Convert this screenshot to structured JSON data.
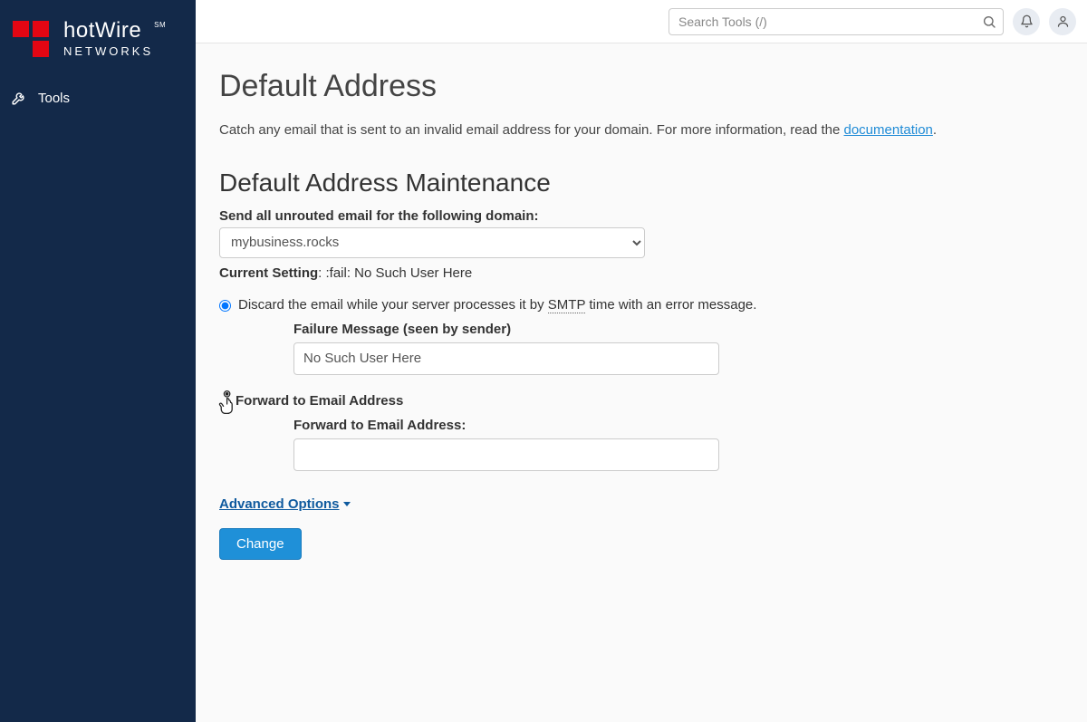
{
  "brand": {
    "name": "hotWire",
    "mark": "SM",
    "sub": "NETWORKS"
  },
  "sidebar": {
    "tools_label": "Tools"
  },
  "topbar": {
    "search_placeholder": "Search Tools (/)"
  },
  "page": {
    "title": "Default Address",
    "intro_prefix": "Catch any email that is sent to an invalid email address for your domain. For more information, read the ",
    "intro_link": "documentation",
    "intro_suffix": "."
  },
  "section": {
    "title": "Default Address Maintenance",
    "domain_label": "Send all unrouted email for the following domain:",
    "domain_value": "mybusiness.rocks",
    "current_setting_label": "Current Setting",
    "current_setting_value": ": :fail: No Such User Here"
  },
  "options": {
    "discard_prefix": "Discard the email while your server processes it by ",
    "discard_smtp": "SMTP",
    "discard_suffix": " time with an error message.",
    "failure_label": "Failure Message (seen by sender)",
    "failure_value": "No Such User Here",
    "forward_radio_label": "Forward to Email Address",
    "forward_field_label": "Forward to Email Address:",
    "forward_value": ""
  },
  "advanced_label": "Advanced Options",
  "change_button": "Change"
}
